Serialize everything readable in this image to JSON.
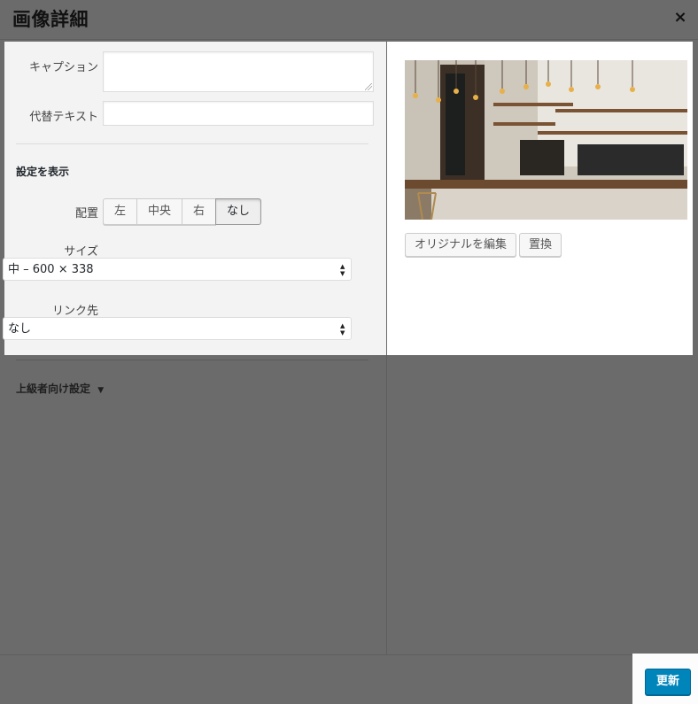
{
  "modal": {
    "title": "画像詳細",
    "close_glyph": "×",
    "close_icon": "close-icon"
  },
  "settings": {
    "caption_label": "キャプション",
    "caption_value": "",
    "alt_label": "代替テキスト",
    "alt_value": "",
    "display_section": "設定を表示",
    "align_label": "配置",
    "align_options": [
      "左",
      "中央",
      "右",
      "なし"
    ],
    "align_selected": "なし",
    "size_label": "サイズ",
    "size_value": "中 – 600 × 338",
    "link_label": "リンク先",
    "link_value": "なし",
    "select_arrows": [
      "▲",
      "▼"
    ]
  },
  "preview": {
    "edit_original": "オリジナルを編集",
    "replace": "置換"
  },
  "advanced": {
    "label": "上級者向け設定",
    "arrow": "▼",
    "arrow_icon": "caret-down-icon"
  },
  "footer": {
    "update": "更新"
  },
  "colors": {
    "overlay": "#6b6b6b",
    "primary": "#0085ba"
  }
}
